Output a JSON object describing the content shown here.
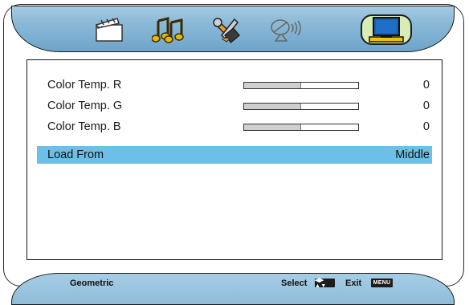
{
  "tabs": [
    {
      "icon": "clapperboard-icon",
      "active": false
    },
    {
      "icon": "music-notes-icon",
      "active": false
    },
    {
      "icon": "tools-icon",
      "active": false
    },
    {
      "icon": "satellite-dish-icon",
      "active": false
    },
    {
      "icon": "monitor-icon",
      "active": true
    }
  ],
  "menu": {
    "items": [
      {
        "label": "Color Temp. R",
        "value": "0",
        "level": 0.5
      },
      {
        "label": "Color Temp. G",
        "value": "0",
        "level": 0.5
      },
      {
        "label": "Color Temp. B",
        "value": "0",
        "level": 0.5
      },
      {
        "label": "Load From",
        "value": "Middle",
        "selected": true
      }
    ]
  },
  "footer": {
    "section": "Geometric",
    "select_label": "Select",
    "exit_label": "Exit",
    "menu_key": "MENU",
    "nav_key": "◀▶ ▲▼"
  },
  "colors": {
    "bar_blue": "#8cbad8",
    "highlight": "#6cbfe8",
    "active_tab": "#d8ecb6"
  }
}
